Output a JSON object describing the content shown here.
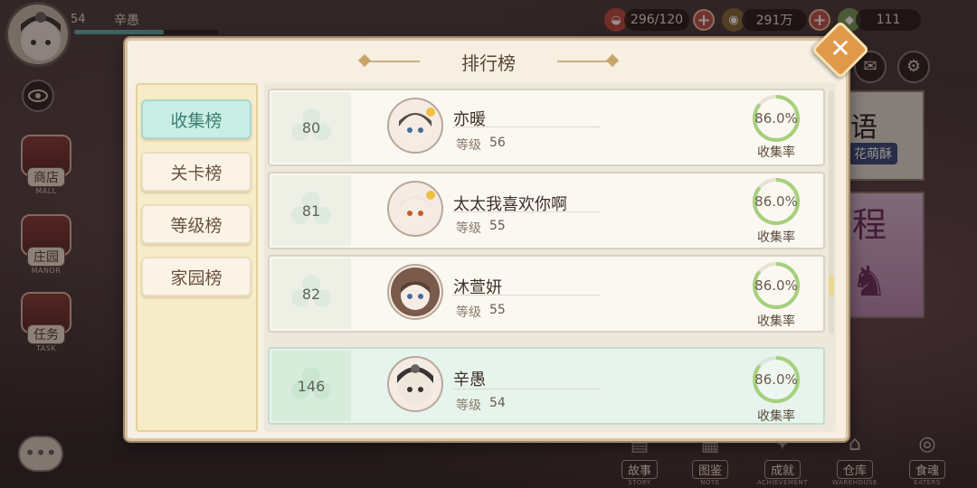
{
  "player": {
    "level": "54",
    "name": "辛愚",
    "exp_fraction": 0.62
  },
  "resources": {
    "stamina": "296/120",
    "coins": "291万",
    "gems": "111"
  },
  "side_menu": [
    {
      "label": "商店",
      "sub": "MALL"
    },
    {
      "label": "庄园",
      "sub": "MANOR"
    },
    {
      "label": "任务",
      "sub": "TASK"
    }
  ],
  "bottom_menu": [
    {
      "label": "故事",
      "sub": "STORY"
    },
    {
      "label": "图鉴",
      "sub": "NOTE"
    },
    {
      "label": "成就",
      "sub": "ACHIEVEMENT"
    },
    {
      "label": "仓库",
      "sub": "WAREHOUSE"
    },
    {
      "label": "食魂",
      "sub": "EATERS"
    }
  ],
  "right_banner": {
    "text1": "语",
    "tag": "花萌酥",
    "text2": "程"
  },
  "dialog": {
    "title": "排行榜",
    "close": "✕",
    "tabs": [
      "收集榜",
      "关卡榜",
      "等级榜",
      "家园榜"
    ],
    "active_tab": 0,
    "level_label": "等级",
    "rate_label": "收集率",
    "rows": [
      {
        "rank": "80",
        "name": "亦暖",
        "level": "56",
        "rate": "86.0%",
        "rate_value": 0.86
      },
      {
        "rank": "81",
        "name": "太太我喜欢你啊",
        "level": "55",
        "rate": "86.0%",
        "rate_value": 0.86
      },
      {
        "rank": "82",
        "name": "沐萱妍",
        "level": "55",
        "rate": "86.0%",
        "rate_value": 0.86
      }
    ],
    "mine": {
      "rank": "146",
      "name": "辛愚",
      "level": "54",
      "rate": "86.0%",
      "rate_value": 0.86
    }
  },
  "colors": {
    "accent_teal": "#62b0a8",
    "tab_active_bg": "#c9eee6",
    "close_orange": "#e0984a"
  }
}
